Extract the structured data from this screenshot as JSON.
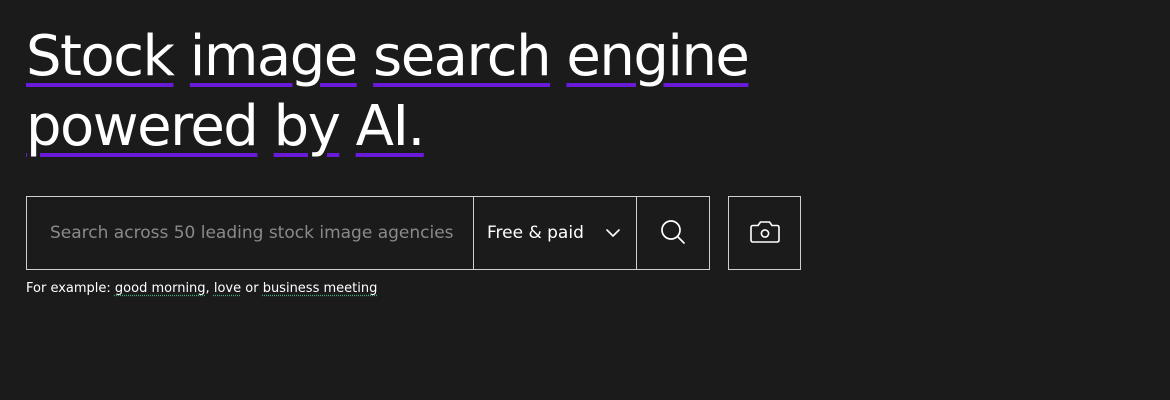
{
  "hero": {
    "headline_parts": [
      "Stock",
      "image",
      "search",
      "engine",
      "powered",
      "by",
      "AI."
    ]
  },
  "search": {
    "placeholder": "Search across 50 leading stock image agencies",
    "value": "",
    "filter_selected": "Free & paid"
  },
  "icons": {
    "filter_chevron": "chevron-down-icon",
    "search": "search-icon",
    "camera": "camera-icon"
  },
  "examples": {
    "prefix": "For example:",
    "items": [
      "good morning",
      "love",
      "business meeting"
    ],
    "separator": ",",
    "conjunction": "or"
  },
  "colors": {
    "background": "#1b1b1c",
    "accent_underline": "#6a1bd8",
    "example_underline": "#3fae7a"
  }
}
